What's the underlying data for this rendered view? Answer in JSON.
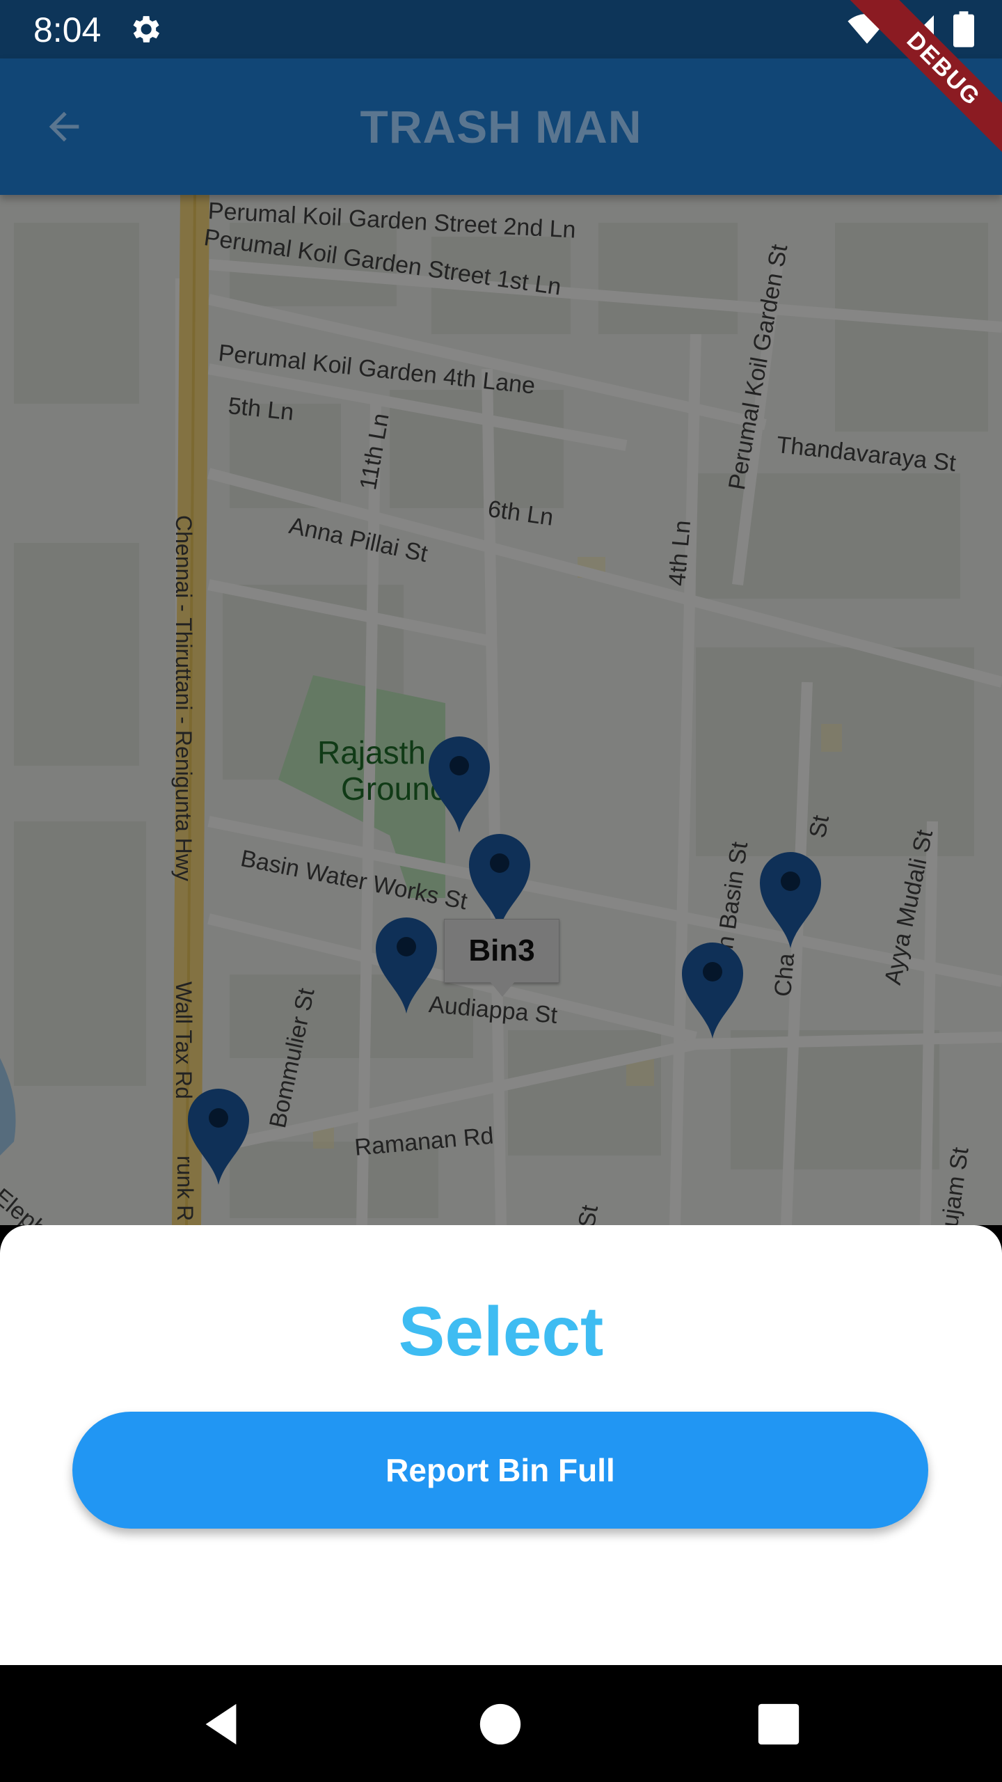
{
  "status_bar": {
    "time": "8:04",
    "icons": [
      "gear-icon",
      "wifi-icon",
      "signal-icon",
      "battery-icon"
    ]
  },
  "app_bar": {
    "title": "TRASH MAN",
    "back_icon": "arrow-back-icon"
  },
  "debug_banner": {
    "label": "DEBUG"
  },
  "map": {
    "streets": [
      "Perumal Koil Garden Street 2nd Ln",
      "Perumal Koil Garden Street 1st Ln",
      "Perumal Koil Garden 4th Lane",
      "5th Ln",
      "11th Ln",
      "6th Ln",
      "Anna Pillai St",
      "4th Ln",
      "Perumal Koil Garden St",
      "Thandavaraya St",
      "Chennai - Thiruttani - Renigunta Hwy",
      "Rajasth",
      "Grounc",
      "Basin Water Works St",
      "Audiappa St",
      "Bommulier St",
      "Wall Tax Rd",
      "Ramanan Rd",
      "yan Basin St",
      "Cha",
      "St",
      "Ayya Mudali St",
      "runk R",
      "Eleph",
      "St",
      "ujam St"
    ],
    "markers": [
      "marker-1",
      "marker-2",
      "marker-3",
      "marker-4",
      "marker-5",
      "marker-6"
    ],
    "info_window": {
      "label": "Bin3"
    },
    "colors": {
      "marker": "#1c5aa1",
      "park": "#b9dfb7",
      "highway": "#f2d37a"
    }
  },
  "sheet": {
    "title": "Select",
    "button_label": "Report Bin Full",
    "colors": {
      "title": "#3ebcf2",
      "button": "#2196f3"
    }
  },
  "nav_bar": {
    "items": [
      "back-nav-icon",
      "home-nav-icon",
      "recents-nav-icon"
    ]
  }
}
